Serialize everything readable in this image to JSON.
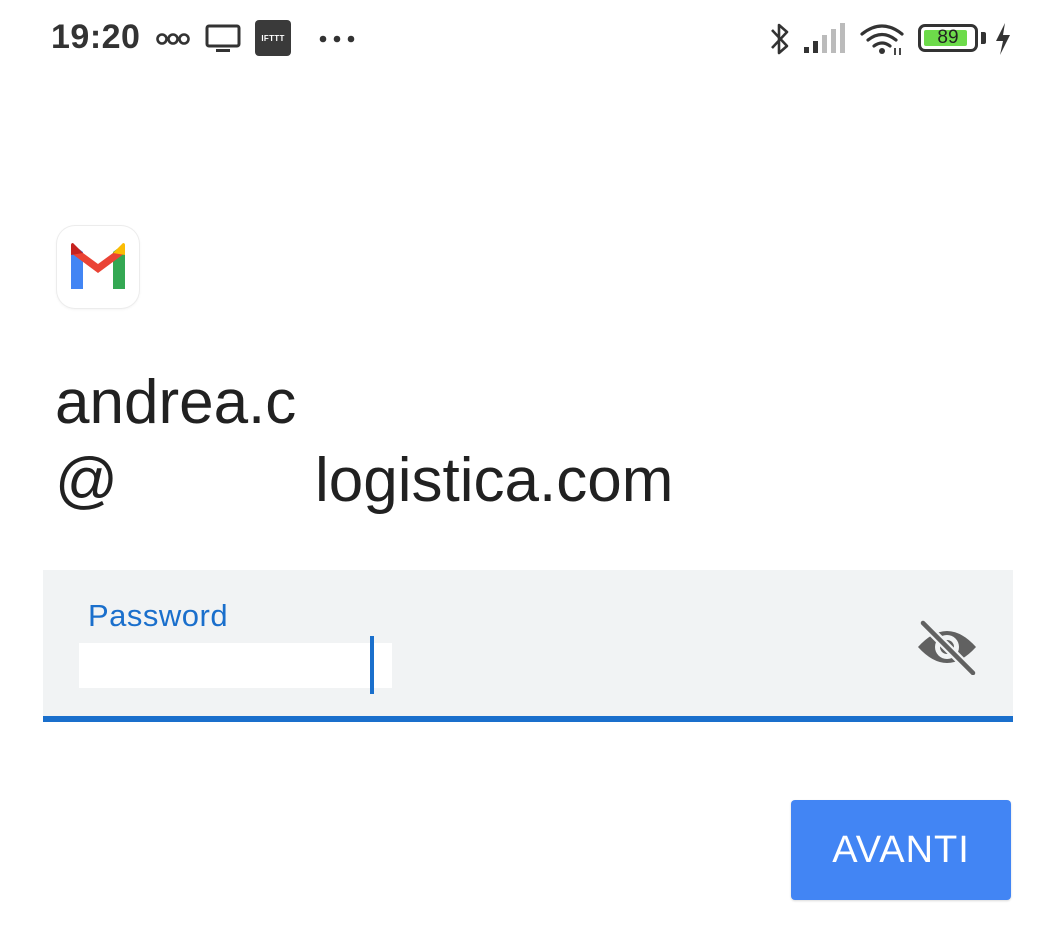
{
  "status_bar": {
    "time": "19:20",
    "left_icons": [
      "infinity-icon",
      "cast-screen-icon",
      "ifttt-icon",
      "more-dots-icon"
    ],
    "ifttt_label": "IFTTT",
    "right_icons": [
      "bluetooth-icon",
      "signal-icon",
      "wifi-icon",
      "battery-icon",
      "charging-icon"
    ],
    "battery_level": "89",
    "battery_fill_fraction": 0.89,
    "battery_color": "#6ddb4a"
  },
  "app": {
    "logo": "gmail-logo"
  },
  "account": {
    "email_line1": "andrea.c",
    "email_at": "@",
    "email_domain": "logistica.com"
  },
  "password_field": {
    "label": "Password",
    "value": "",
    "visibility_icon": "eye-off-icon",
    "accent_color": "#1a6fcc"
  },
  "actions": {
    "next_label": "AVANTI",
    "next_color": "#4285f4"
  }
}
